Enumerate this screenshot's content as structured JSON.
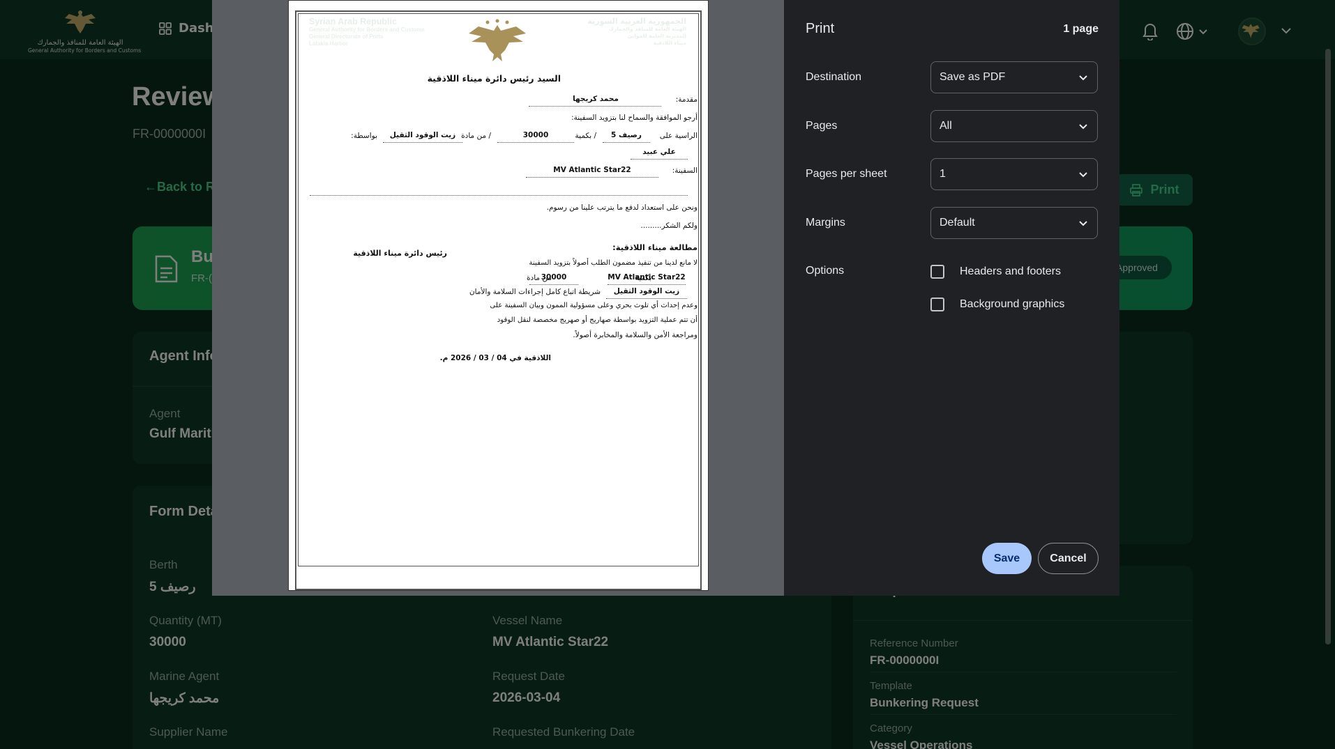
{
  "app": {
    "logo_line1": "الهيئة العامة للمنافذ والجمارك",
    "logo_line2": "General Authority for Borders and Customs",
    "nav_dashboard": "Dashb",
    "colors": {
      "accent": "#4ed08b",
      "hero": "#1ea552",
      "background": "#0a2c1d"
    }
  },
  "page": {
    "title": "Review",
    "reference": "FR-0000000I",
    "back_link": "←Back to R",
    "print_label": "Print",
    "hero_title": "Bu",
    "hero_sub": "FR-(",
    "status_badge": "Approved"
  },
  "agent_card": {
    "title": "Agent Info",
    "agent_label": "Agent",
    "agent_value": "Gulf Mariti"
  },
  "form_card": {
    "title": "Form Deta",
    "fields": {
      "berth_label": "Berth",
      "berth_value": "رصيف 5",
      "quantity_label": "Quantity (MT)",
      "quantity_value": "30000",
      "vessel_label": "Vessel Name",
      "vessel_value": "MV Atlantic Star22",
      "marine_agent_label": "Marine Agent",
      "marine_agent_value": "محمد كريجها",
      "request_date_label": "Request Date",
      "request_date_value": "2026-03-04",
      "supplier_label": "Supplier Name",
      "bunkering_date_label": "Requested Bunkering Date"
    }
  },
  "request_card": {
    "title": "Request Information",
    "ref_label": "Reference Number",
    "ref_value": "FR-0000000I",
    "template_label": "Template",
    "template_value": "Bunkering Request",
    "category_label": "Category",
    "category_value": "Vessel Operations"
  },
  "print_dialog": {
    "title": "Print",
    "page_count": "1 page",
    "destination_label": "Destination",
    "destination_value": "Save as PDF",
    "pages_label": "Pages",
    "pages_value": "All",
    "pages_per_sheet_label": "Pages per sheet",
    "pages_per_sheet_value": "1",
    "margins_label": "Margins",
    "margins_value": "Default",
    "options_label": "Options",
    "opt_headers": "Headers and footers",
    "opt_background": "Background graphics",
    "save": "Save",
    "cancel": "Cancel"
  },
  "document": {
    "en_line1": "Syrian Arab Republic",
    "en_line2": "General Authority for Borders and Customs",
    "en_line3": "General Directorate of Ports",
    "en_line4": "Latakia Harbor",
    "ar_line1": "الجمهورية العربية السورية",
    "ar_line2": "الهيئة العامة للمنافذ والجمارك",
    "ar_line3": "المديرية العامة للموانئ",
    "ar_line4": "ميناء اللاذقية",
    "addressee": "السيد رئيس دائرة ميناء اللاذقية",
    "presenter_label": "مقدمة:",
    "presenter_value": "محمد كريجها",
    "request_line": "أرجو الموافقة والسماح لنا بتزويد السفينة:",
    "docked_label": "الراسية على",
    "berth_value": "رصيف 5",
    "qty_label": "/ بكمية",
    "qty_value": "30000",
    "material_label": "/ من مادة",
    "material_value": "زيت الوقود الثقيل",
    "via_label": "بواسطة:",
    "via_value": "علي عبيد",
    "ship_label": "السفينة:",
    "ship_value": "MV Atlantic Star22",
    "pay_line": "ونحن على استعداد لدفع ما يترتب علينا من رسوم.",
    "thanks_line": "ولكم الشكر.........",
    "review_title": "مطالعة ميناء اللاذقية:",
    "review_line1": "لا مانع لدينا من تنفيذ مضمون الطلب أصولاً بتزويد السفينة",
    "review_ship": "MV Atlantic Star22",
    "review_qty_label": "بكمية",
    "review_qty": "30000",
    "review_from": "من مادة",
    "review_material": "زيت الوقود الثقيل",
    "review_line2": "شريطة اتباع كامل إجراءات السلامة والأمان",
    "review_line3": "وعدم إحداث أي تلوث بحري وعلى مسؤولية الممون وبيان السفينة على",
    "review_line4": "أن تتم عملية التزويد بواسطة صهاريج أو صهريج مخصصة لنقل الوقود",
    "review_line5": "ومراجعة الأمن والسلامة والمخابرة أصولاً.",
    "signature": "رئيس دائرة ميناء اللاذقية",
    "date_line": "اللاذقية في 04 / 03 / 2026 م."
  }
}
